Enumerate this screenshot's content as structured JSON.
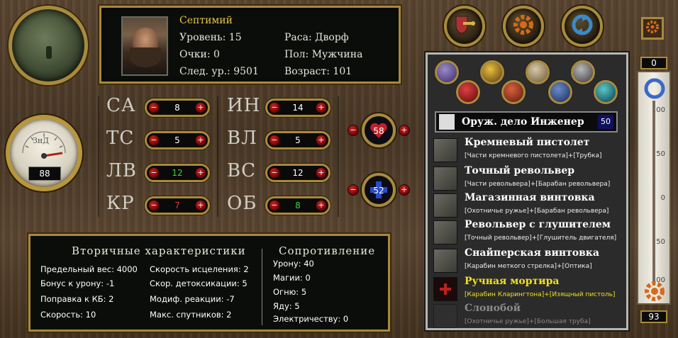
{
  "character": {
    "name": "Септимий",
    "level": "Уровень: 15",
    "points": "Очки: 0",
    "next_level": "След. ур.: 9501",
    "race": "Раса: Дворф",
    "gender": "Пол: Мужчина",
    "age": "Возраст: 101"
  },
  "gauge": {
    "label": "ЗнД",
    "value": "88"
  },
  "stats_left": [
    {
      "label": "СА",
      "value": "8",
      "color": "#ffffff"
    },
    {
      "label": "ТС",
      "value": "5",
      "color": "#ffffff"
    },
    {
      "label": "ЛВ",
      "value": "12",
      "color": "#35d735"
    },
    {
      "label": "КР",
      "value": "7",
      "color": "#e53030"
    }
  ],
  "stats_right": [
    {
      "label": "ИН",
      "value": "14",
      "color": "#ffffff"
    },
    {
      "label": "ВЛ",
      "value": "5",
      "color": "#ffffff"
    },
    {
      "label": "ВС",
      "value": "12",
      "color": "#ffffff"
    },
    {
      "label": "ОБ",
      "value": "8",
      "color": "#35d735"
    }
  ],
  "hp": "58",
  "fatigue": "52",
  "secondary": {
    "title": "Вторичные характеристики",
    "col1": [
      "Предельный вес: 4000",
      "Бонус к урону: -1",
      "Поправка к КБ: 2",
      "Скорость: 10"
    ],
    "col2": [
      "Скорость исцеления: 2",
      "Скор. детоксикации: 5",
      "Модиф. реакции: -7",
      "Макс. спутников: 2"
    ]
  },
  "resistance": {
    "title": "Сопротивление",
    "items": [
      "Урону: 40",
      "Магии: 0",
      "Огню: 5",
      "Яду: 5",
      "Электричеству: 0"
    ]
  },
  "tech": {
    "header": "Оруж. дело Инженер",
    "header_value": "50",
    "items": [
      {
        "name": "Кремневый пистолет",
        "req": "[Части кремневого пистолета]+[Трубка]",
        "state": "known"
      },
      {
        "name": "Точный револьвер",
        "req": "[Части револьвера]+[Барабан револьвера]",
        "state": "known"
      },
      {
        "name": "Магазинная винтовка",
        "req": "[Охотничье ружье]+[Барабан револьвера]",
        "state": "known"
      },
      {
        "name": "Револьвер с глушителем",
        "req": "[Точный револьвер]+[Глушитель двигателя]",
        "state": "known"
      },
      {
        "name": "Снайперская винтовка",
        "req": "[Карабин меткого стрелка]+[Оптика]",
        "state": "known"
      },
      {
        "name": "Ручная мортира",
        "req": "[Карабин Кларингтона]+[Изящный пистоль]",
        "state": "selected"
      },
      {
        "name": "Слонобой",
        "req": "[Охотничье ружье]+[Большая труба]",
        "state": "locked"
      }
    ]
  },
  "thermometer": {
    "top_value": "0",
    "bottom_value": "93",
    "ticks": [
      "100",
      "50",
      "0",
      "50",
      "100"
    ]
  },
  "colors": {
    "gold": "#e8c34a",
    "selected_item": "#f0e020",
    "locked_item": "#8a8a8a",
    "brass_border": "#a88a3c"
  },
  "icons": {
    "top_buttons": [
      "shield-key-icon",
      "gear-icon",
      "cycle-arrows-icon"
    ],
    "corner_button": "tech-gear-icon",
    "schools": [
      "bottle-icon",
      "lightning-icon",
      "gun-icon",
      "flask-red-icon",
      "orb-red-icon",
      "gears-icon",
      "anvil-icon",
      "flask-blue-icon",
      "caduceus-icon"
    ]
  }
}
